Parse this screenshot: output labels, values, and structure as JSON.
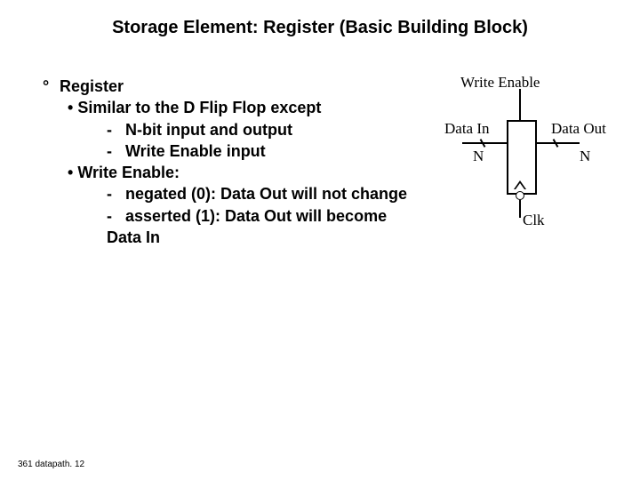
{
  "title": "Storage Element: Register (Basic Building Block)",
  "bullets": {
    "deg": "°",
    "register": "Register",
    "b1": " Similar to the D Flip Flop except",
    "b1a": "N-bit input and output",
    "b1b": "Write Enable input",
    "b2": " Write Enable:",
    "b2a": "negated  (0): Data Out will not change",
    "b2b": "asserted (1): Data Out will become Data In"
  },
  "diagram": {
    "write_enable": "Write Enable",
    "data_in": "Data In",
    "data_out": "Data Out",
    "n_left": "N",
    "n_right": "N",
    "clk": "Clk"
  },
  "footer": "361 datapath. 12"
}
